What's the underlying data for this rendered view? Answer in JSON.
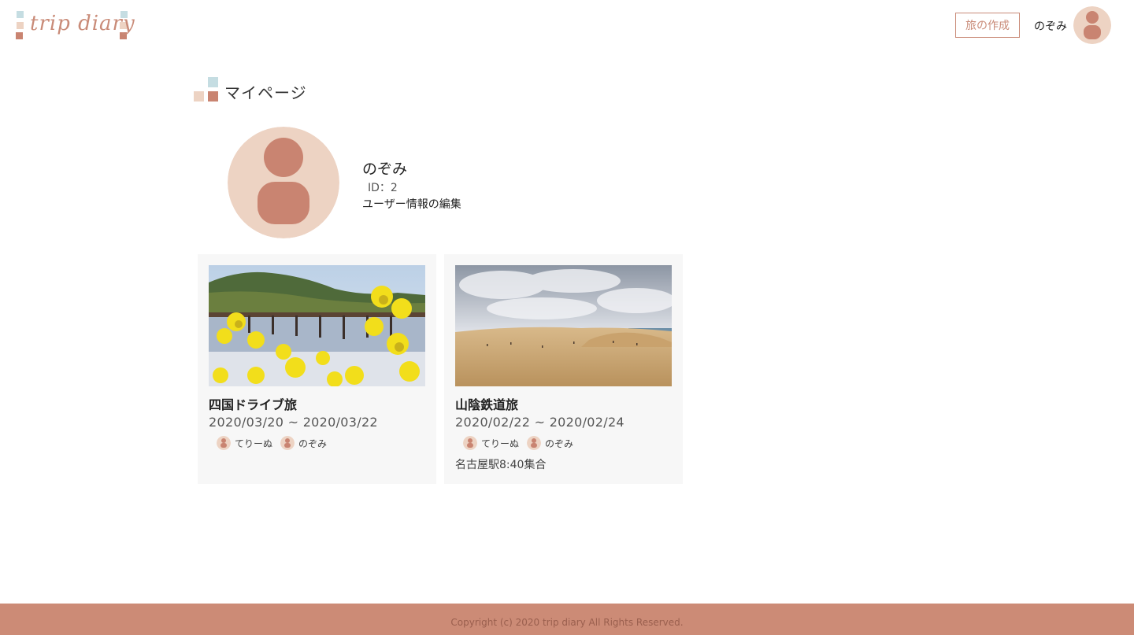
{
  "header": {
    "logo_text": "trip diary",
    "create_trip_label": "旅の作成",
    "username": "のぞみ",
    "avatar_icon": "user-avatar-icon"
  },
  "page": {
    "title": "マイページ"
  },
  "profile": {
    "name": "のぞみ",
    "id_text": "ID：2",
    "edit_link": "ユーザー情報の編集",
    "avatar_icon": "user-avatar-icon"
  },
  "trips": [
    {
      "title": "四国ドライブ旅",
      "dates": "2020/03/20 ~ 2020/03/22",
      "members": [
        "てりーぬ",
        "のぞみ"
      ],
      "note": "",
      "photo_icon": "bridge-flowers-photo"
    },
    {
      "title": "山陰鉄道旅",
      "dates": "2020/02/22 ~ 2020/02/24",
      "members": [
        "てりーぬ",
        "のぞみ"
      ],
      "note": "名古屋駅8:40集合",
      "photo_icon": "sand-dunes-photo"
    }
  ],
  "footer": {
    "copyright": "Copyright (c) 2020 trip diary All Rights Reserved."
  },
  "colors": {
    "accent": "#c98b78",
    "avatar_bg": "#edd3c3",
    "avatar_fg": "#c98471",
    "footer_bg": "#cc8b76",
    "card_bg": "#f7f7f7",
    "logo_blue": "#c5dde2",
    "logo_beige": "#edd3c3",
    "logo_brown": "#c98471"
  }
}
